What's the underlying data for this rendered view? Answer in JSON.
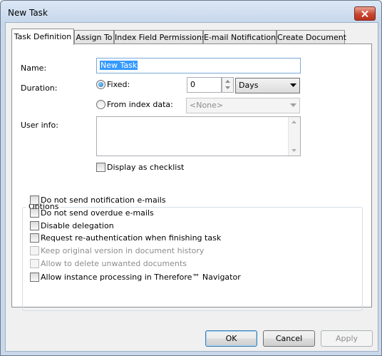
{
  "window": {
    "title": "New Task"
  },
  "tabs": [
    {
      "label": "Task Definition"
    },
    {
      "label": "Assign To"
    },
    {
      "label": "Index Field Permissions"
    },
    {
      "label": "E-mail Notifications"
    },
    {
      "label": "Create Document"
    }
  ],
  "form": {
    "name_label": "Name:",
    "name_value": "New Task",
    "duration_label": "Duration:",
    "fixed_label": "Fixed:",
    "fixed_value": "0",
    "unit_value": "Days",
    "from_index_label": "From index data:",
    "from_index_value": "<None>",
    "user_info_label": "User info:",
    "display_checklist_label": "Display as checklist"
  },
  "options": {
    "title": "Options",
    "items": [
      {
        "label": "Do not send notification e-mails",
        "enabled": true
      },
      {
        "label": "Do not send overdue e-mails",
        "enabled": true
      },
      {
        "label": "Disable delegation",
        "enabled": true
      },
      {
        "label": "Request re-authentication when finishing task",
        "enabled": true
      },
      {
        "label": "Keep original version in document history",
        "enabled": false
      },
      {
        "label": "Allow to delete unwanted documents",
        "enabled": false
      },
      {
        "label": "Allow instance processing in Therefore™ Navigator",
        "enabled": true
      }
    ]
  },
  "buttons": {
    "ok": "OK",
    "cancel": "Cancel",
    "apply": "Apply"
  }
}
